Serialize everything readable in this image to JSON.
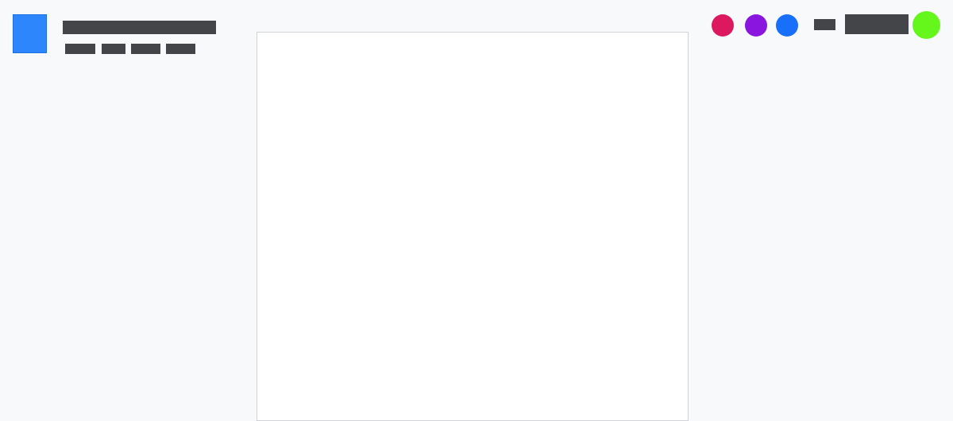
{
  "header": {
    "logo_color": "#2d86fb",
    "doc_title": "",
    "menu": [
      "",
      "",
      "",
      ""
    ]
  },
  "collaborators": [
    {
      "icon": "avatar-dot",
      "color": "#dc195f"
    },
    {
      "icon": "avatar-dot",
      "color": "#8a15de"
    },
    {
      "icon": "avatar-dot",
      "color": "#176ffa"
    }
  ],
  "toolbar": {
    "share_link_label": "",
    "share_button_label": ""
  },
  "user": {
    "icon": "user-avatar-icon",
    "avatar_color": "#65f71c"
  },
  "canvas": {
    "background": "#ffffff"
  },
  "colors": {
    "page_background": "#f8f9fb",
    "redaction": "#434549"
  }
}
